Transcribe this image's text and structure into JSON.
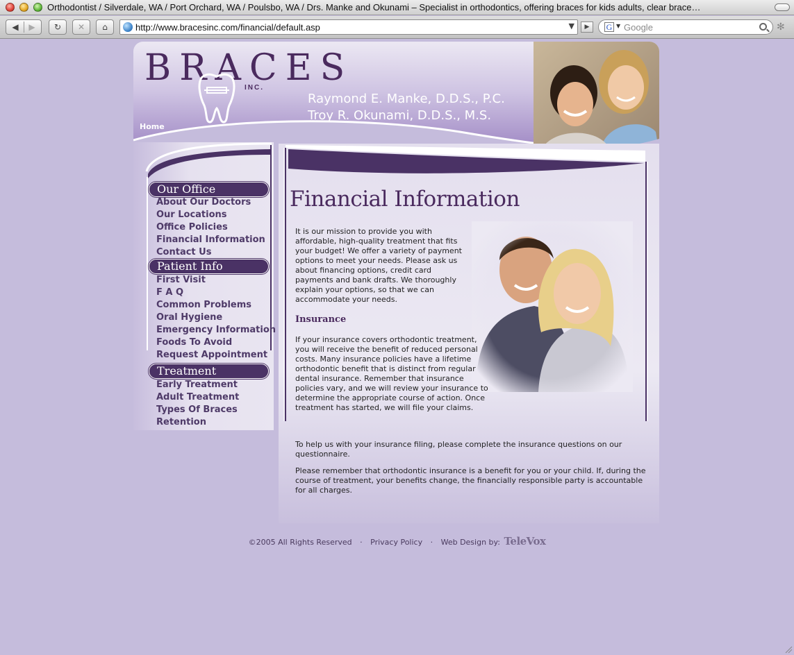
{
  "window": {
    "title": "Orthodontist / Silverdale, WA / Port Orchard, WA / Poulsbo, WA / Drs. Manke and Okunami – Specialist in orthodontics, offering braces for kids adults, clear brace…"
  },
  "toolbar": {
    "back_icon": "◀",
    "forward_icon": "▶",
    "reload_icon": "↻",
    "stop_icon": "✕",
    "home_icon": "⌂",
    "url": "http://www.bracesinc.com/financial/default.asp",
    "search_placeholder": "Google",
    "search_engine_letter": "G"
  },
  "header": {
    "logo": "BRACES",
    "logo_suffix": "INC.",
    "doctor_1": "Raymond E. Manke, D.D.S., P.C.",
    "doctor_2": "Troy R. Okunami, D.D.S., M.S.",
    "home_link": "Home"
  },
  "sidebar": {
    "sections": [
      {
        "title": "Our Office",
        "items": [
          "About Our Doctors",
          "Our Locations",
          "Office Policies",
          "Financial Information",
          "Contact Us"
        ]
      },
      {
        "title": "Patient Info",
        "items": [
          "First Visit",
          "F A Q",
          "Common Problems",
          "Oral Hygiene",
          "Emergency Information",
          "Foods To Avoid",
          "Request Appointment"
        ]
      },
      {
        "title": "Treatment",
        "items": [
          "Early Treatment",
          "Adult Treatment",
          "Types Of Braces",
          "Retention"
        ]
      }
    ]
  },
  "main": {
    "title": "Financial Information",
    "intro": "It is our mission to provide you with affordable, high-quality treatment that fits your budget! We offer a variety of payment options to meet your needs. Please ask us about financing options, credit card payments and bank drafts. We thoroughly explain your options, so that we can accommodate your needs.",
    "insurance_heading": "Insurance",
    "insurance_text": "If your insurance covers orthodontic treatment, you will receive the benefit of reduced personal costs. Many insurance policies have a lifetime orthodontic benefit that is distinct from regular dental insurance. Remember that insurance policies vary, and we will review your insurance to determine the appropriate course of action. Once treatment has started, we will file your claims.",
    "filing_text": "To help us with your insurance filing, please complete the insurance questions on our questionnaire.",
    "remember_text": "Please remember that orthodontic insurance is a benefit for you or your child. If, during the course of treatment, your benefits change, the financially responsible party is accountable for all charges."
  },
  "footer": {
    "copyright": "©2005 All Rights Reserved",
    "separator": "·",
    "privacy": "Privacy Policy",
    "design_label": "Web Design by:",
    "design_brand": "TeleVox"
  },
  "colors": {
    "page_background": "#c5bcdc",
    "brand_purple": "#4a2a5e",
    "nav_text": "#4e3a68",
    "nav_header_fill": "#4a3265"
  }
}
